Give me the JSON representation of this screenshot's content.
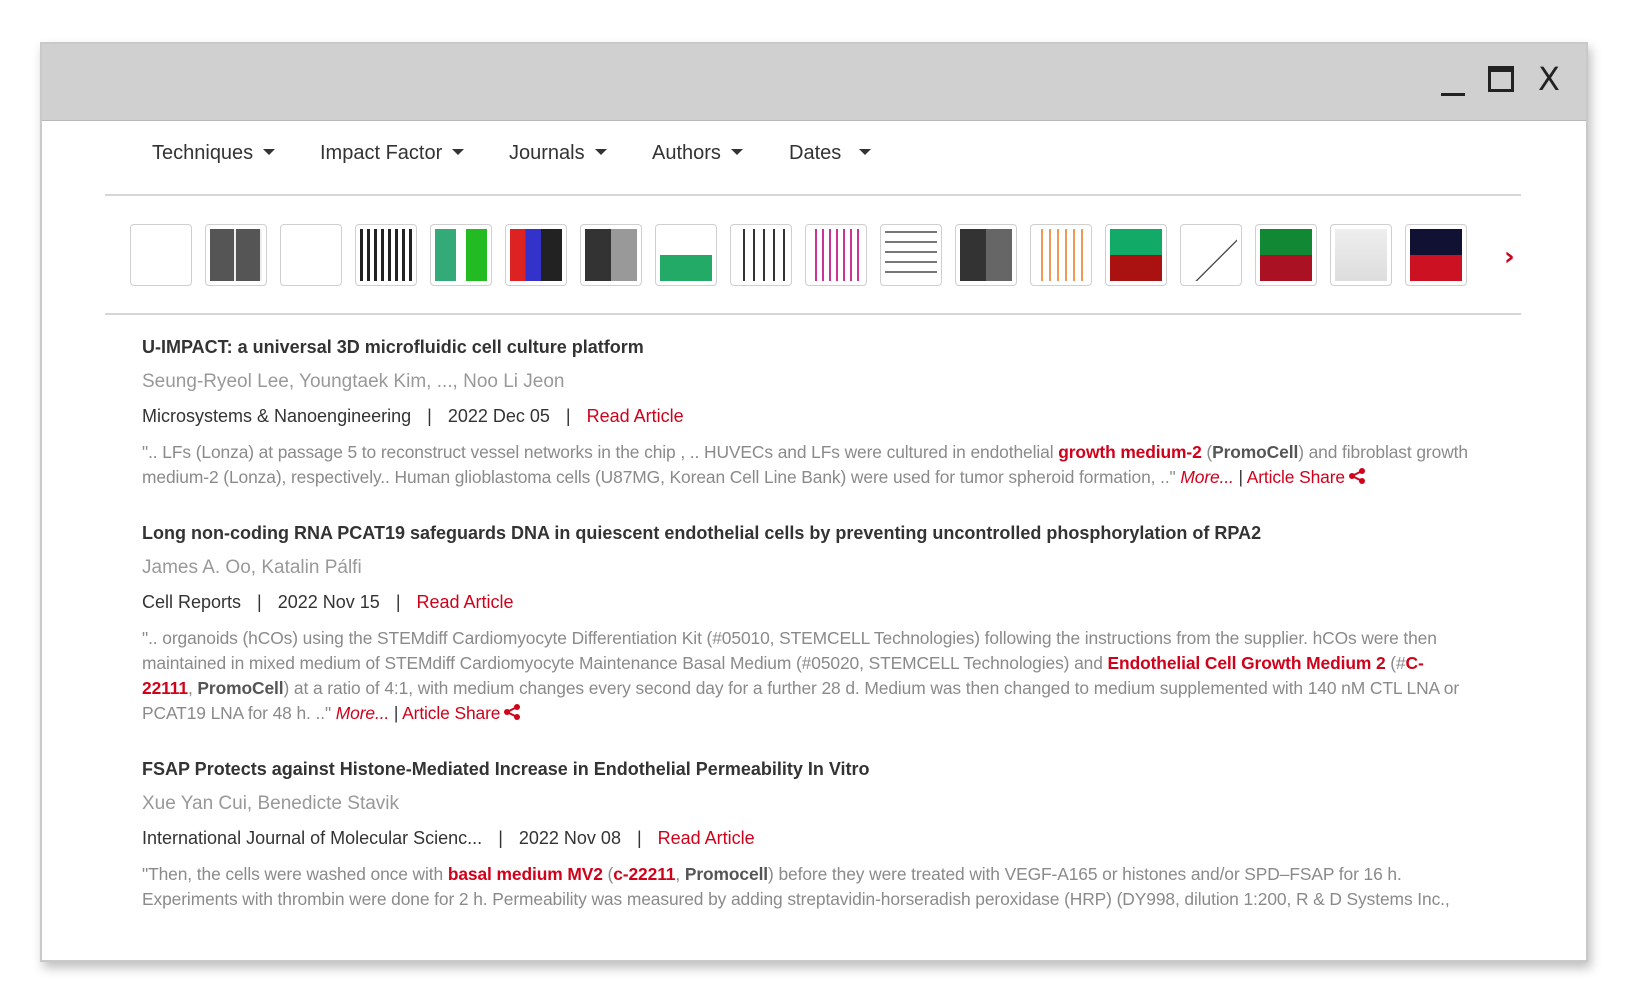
{
  "window": {
    "controls": [
      "minimize",
      "maximize",
      "X"
    ]
  },
  "filters": [
    {
      "label": "Techniques"
    },
    {
      "label": "Impact Factor"
    },
    {
      "label": "Journals"
    },
    {
      "label": "Authors"
    },
    {
      "label": "Dates"
    }
  ],
  "thumbnails": {
    "count": 18,
    "next_icon": "chevron-right-icon"
  },
  "articles": [
    {
      "title": "U-IMPACT: a universal 3D microfluidic cell culture platform",
      "authors": "Seung-Ryeol Lee, Youngtaek Kim, ..., Noo Li Jeon",
      "journal": "Microsystems & Nanoengineering",
      "sep1": "|",
      "date": "2022 Dec 05",
      "sep2": "|",
      "read": "Read Article",
      "snippet_a": "\".. LFs (Lonza) at passage 5 to reconstruct vessel networks in the chip , .. HUVECs and LFs were cultured in endothelial ",
      "hl1": "growth medium-2",
      "snippet_b": " (",
      "hl2": "PromoCell",
      "snippet_c": ") and fibroblast growth medium-2 (Lonza), respectively.. Human glioblastoma cells (U87MG, Korean Cell Line Bank) were used for tumor spheroid formation, ..\" ",
      "more": "More...",
      "divider": " | ",
      "share": "Article Share"
    },
    {
      "title": "Long non-coding RNA PCAT19 safeguards DNA in quiescent endothelial cells by preventing uncontrolled phosphorylation of RPA2",
      "authors": "James A. Oo, Katalin Pálfi",
      "journal": "Cell Reports",
      "sep1": "|",
      "date": "2022 Nov 15",
      "sep2": "|",
      "read": "Read Article",
      "snippet_a": "\".. organoids (hCOs) using the STEMdiff Cardiomyocyte Differentiation Kit (#05010, STEMCELL Technologies) following the instructions from the supplier. hCOs were then maintained in mixed medium of STEMdiff Cardiomyocyte Maintenance Basal Medium (#05020, STEMCELL Technologies) and ",
      "hl1": "Endothelial Cell Growth Medium 2",
      "snippet_b": " (#",
      "hl2": "C-22111",
      "snippet_c": ", ",
      "hl3": "PromoCell",
      "snippet_d": ") at a ratio of 4:1, with medium changes every second day for a further 28 d. Medium was then changed to medium supplemented with 140 nM CTL LNA or PCAT19 LNA for 48 h. ..\" ",
      "more": "More...",
      "divider": " | ",
      "share": "Article Share"
    },
    {
      "title": "FSAP Protects against Histone-Mediated Increase in Endothelial Permeability In Vitro",
      "authors": "Xue Yan Cui, Benedicte Stavik",
      "journal": "International Journal of Molecular Scienc...",
      "sep1": "|",
      "date": "2022 Nov 08",
      "sep2": "|",
      "read": "Read Article",
      "snippet_a": "\"Then, the cells were washed once with ",
      "hl1": "basal medium MV2",
      "snippet_b": " (",
      "hl2": "c-22211",
      "snippet_c": ", ",
      "hl3": "Promocell",
      "snippet_d": ") before they were treated with VEGF-A165 or histones and/or SPD–FSAP for 16 h. Experiments with thrombin were done for 2 h. Permeability was measured by adding streptavidin-horseradish peroxidase (HRP) (DY998, dilution 1:200, R & D Systems Inc.,"
    }
  ]
}
